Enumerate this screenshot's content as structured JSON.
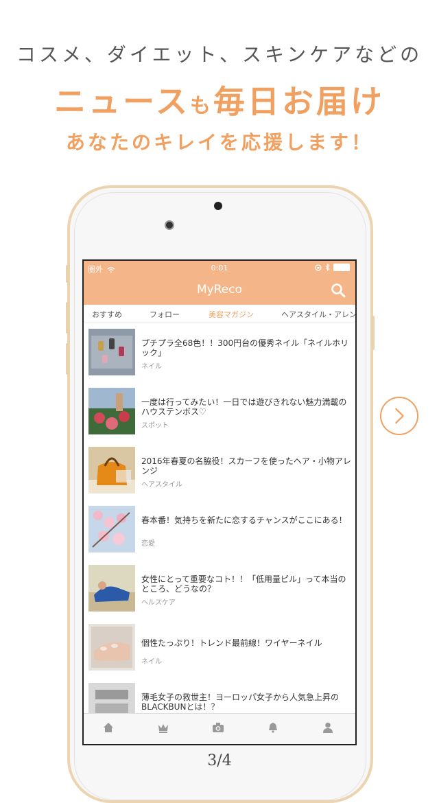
{
  "headline": {
    "line1": "コスメ、ダイエット、スキンケアなどの",
    "line2_main": "ニュース",
    "line2_small": "も",
    "line2_end": "毎日お届け",
    "line3": "あなたのキレイを応援します！"
  },
  "status_bar": {
    "carrier": "圏外",
    "time": "0:01"
  },
  "app": {
    "title": "MyReco"
  },
  "tabs": [
    {
      "label": "おすすめ",
      "active": false
    },
    {
      "label": "フォロー",
      "active": false
    },
    {
      "label": "美容マガジン",
      "active": true
    },
    {
      "label": "ヘアスタイル・アレン",
      "active": false
    }
  ],
  "articles": [
    {
      "title": "プチプラ全68色！！300円台の優秀ネイル「ネイルホリック」",
      "category": "ネイル"
    },
    {
      "title": "一度は行ってみたい！一日では遊びきれない魅力満載のハウステンボス♡",
      "category": "スポット"
    },
    {
      "title": "2016年春夏の名脇役！スカーフを使ったヘア・小物アレンジ",
      "category": "ヘアスタイル"
    },
    {
      "title": "春本番！気持ちを新たに恋するチャンスがここにある！",
      "category": "恋愛"
    },
    {
      "title": "女性にとって重要なコト！！「低用量ピル」って本当のところ、どうなの？",
      "category": "ヘルスケア"
    },
    {
      "title": "個性たっぷり！トレンド最前線！ワイヤーネイル",
      "category": "ネイル"
    },
    {
      "title": "薄毛女子の救世主！ヨーロッパ女子から人気急上昇のBLACKBUNとは！？",
      "category": ""
    }
  ],
  "tabbar": [
    "home-icon",
    "crown-icon",
    "camera-icon",
    "bell-icon",
    "person-icon"
  ],
  "page_indicator": "3/4",
  "colors": {
    "accent": "#f0a060",
    "nav": "#f4b689"
  }
}
